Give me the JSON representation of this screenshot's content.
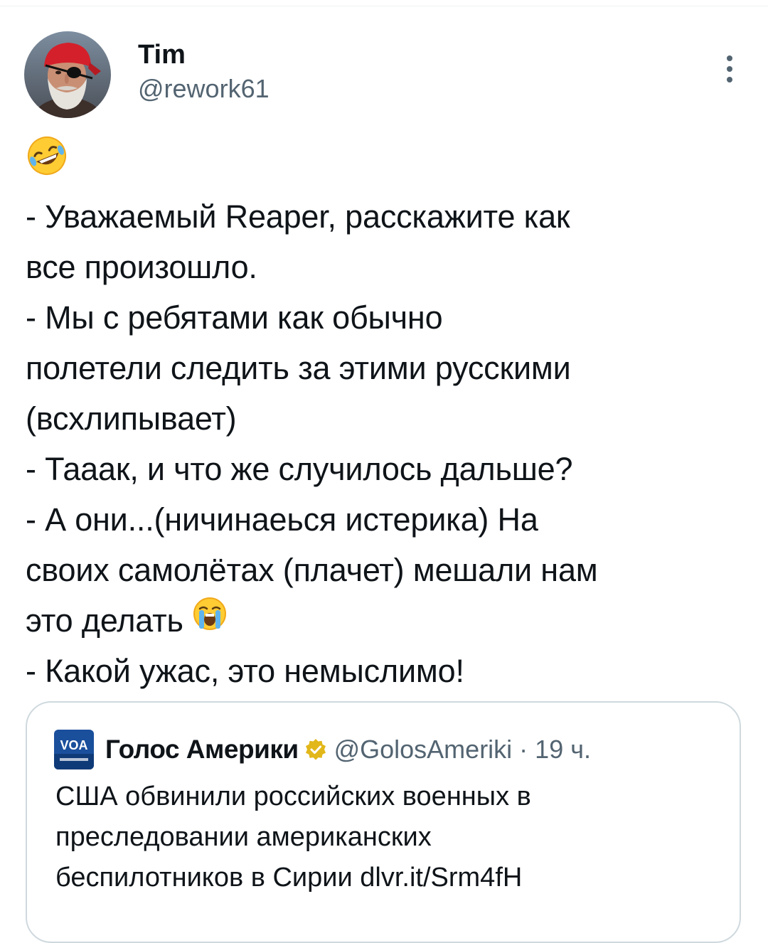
{
  "author": {
    "display_name": "Tim",
    "handle": "@rework61"
  },
  "tweet": {
    "lines": [
      "- Уважаемый Reaper, расскажите как",
      "все произошло.",
      "- Мы с ребятами как обычно",
      "полетели следить за этими русскими",
      "(всхлипывает)",
      "- Тааак, и что же случилось дальше?",
      "- А они...(ничинаеься истерика) На",
      "своих самолётах (плачет) мешали нам",
      "это делать",
      "- Какой ужас, это немыслимо!"
    ],
    "leading_emoji": "rolling-on-floor-laughing-emoji",
    "inline_emoji": "loudly-crying-emoji"
  },
  "quote": {
    "logo": "VOA",
    "name": "Голос Америки",
    "verified": "gold-verified-badge",
    "handle": "@GolosAmeriki",
    "separator": "·",
    "time": "19 ч.",
    "lines": [
      "США обвинили российских военных в",
      "преследовании американских",
      "беспилотников в Сирии dlvr.it/Srm4fH"
    ]
  },
  "colors": {
    "text": "#0f1419",
    "secondary": "#536471",
    "border": "#cfd9de",
    "verified_gold": "#e2b719",
    "voa_blue": "#1a4f9c"
  }
}
